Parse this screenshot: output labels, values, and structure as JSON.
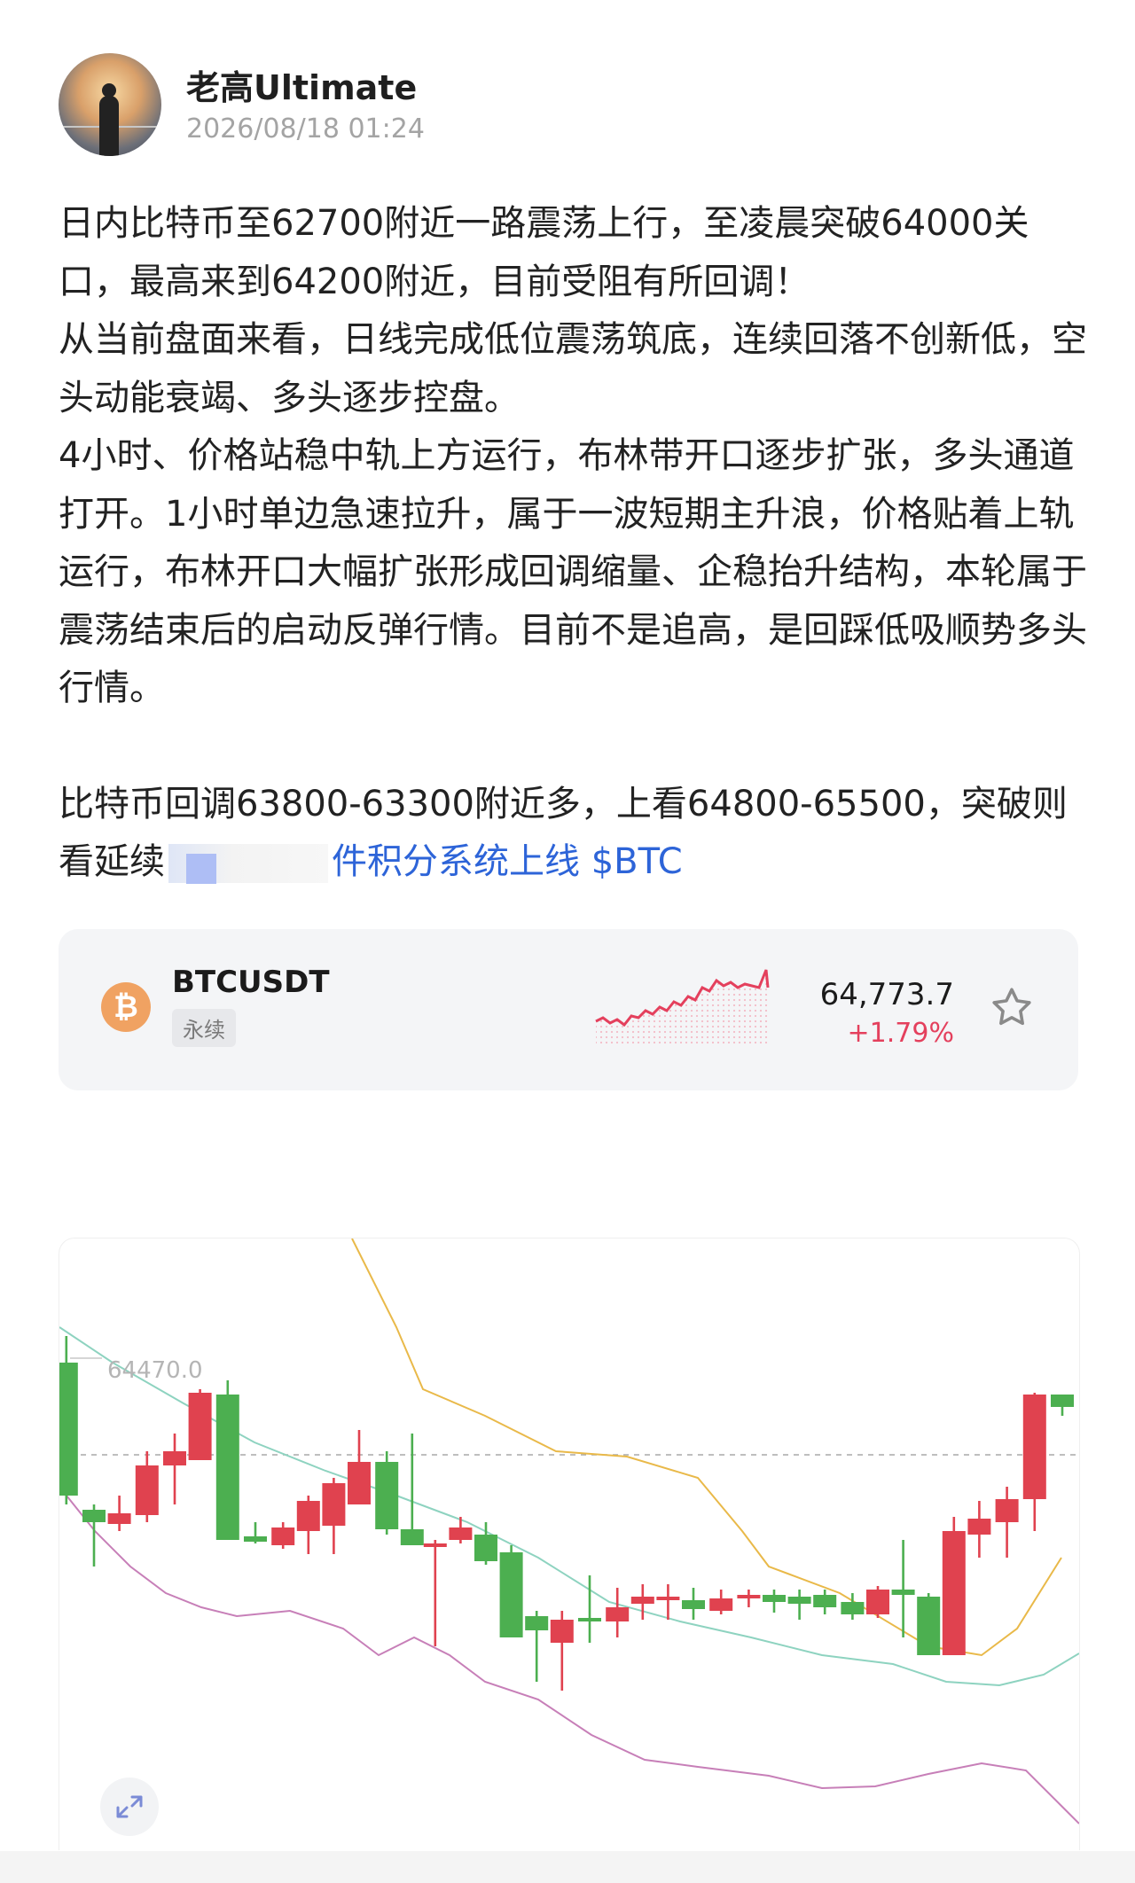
{
  "author": {
    "name": "老高Ultimate",
    "time": "2026/08/18 01:24"
  },
  "post": {
    "paragraphs": [
      "日内比特币至62700附近一路震荡上行，至凌晨突破64000关口，最高来到64200附近，目前受阻有所回调！",
      "从当前盘面来看，日线完成低位震荡筑底，连续回落不创新低，空头动能衰竭、多头逐步控盘。",
      "4小时、价格站稳中轨上方运行，布林带开口逐步扩张，多头通道打开。1小时单边急速拉升，属于一波短期主升浪，价格贴着上轨运行，布林开口大幅扩张形成回调缩量、企稳抬升结构，本轮属于震荡结束后的启动反弹行情。目前不是追高，是回踩低吸顺势多头行情。"
    ],
    "strategy": "比特币回调63800-63300附近多，上看64800-65500，突破则看延续",
    "link_text": "件积分系统上线",
    "tag": "$BTC"
  },
  "ticker": {
    "symbol": "BTCUSDT",
    "type": "永续",
    "price": "64,773.7",
    "change": "+1.79%",
    "logo_glyph": "₿",
    "up_color": "#e4405d"
  },
  "chart": {
    "price_label": "64470.0",
    "colors": {
      "up": "#e0424f",
      "down": "#4caf50",
      "upper_band": "#e9b949",
      "middle_band": "#8ed3c0",
      "lower_band": "#c77fb8"
    }
  }
}
